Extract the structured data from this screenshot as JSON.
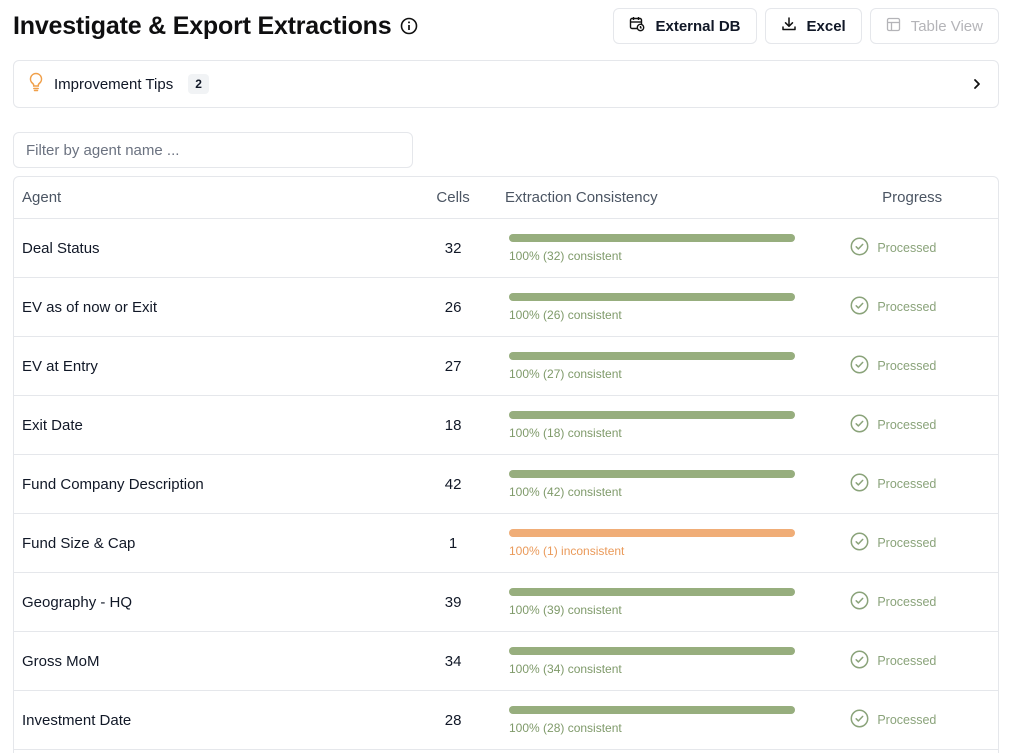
{
  "header": {
    "title": "Investigate & Export Extractions",
    "info_icon": "info-icon",
    "actions": {
      "external_db": "External DB",
      "excel": "Excel",
      "table_view": "Table View"
    }
  },
  "tips": {
    "icon": "lightbulb-icon",
    "label": "Improvement Tips",
    "count": "2"
  },
  "filter": {
    "placeholder": "Filter by agent name ..."
  },
  "table": {
    "headers": {
      "agent": "Agent",
      "cells": "Cells",
      "consistency": "Extraction Consistency",
      "progress": "Progress"
    },
    "rows": [
      {
        "agent": "Deal Status",
        "cells": "32",
        "consistency_text": "100% (32) consistent",
        "fraction": 1.0,
        "status": "ok",
        "progress": "Processed"
      },
      {
        "agent": "EV as of now or Exit",
        "cells": "26",
        "consistency_text": "100% (26) consistent",
        "fraction": 1.0,
        "status": "ok",
        "progress": "Processed"
      },
      {
        "agent": "EV at Entry",
        "cells": "27",
        "consistency_text": "100% (27) consistent",
        "fraction": 1.0,
        "status": "ok",
        "progress": "Processed"
      },
      {
        "agent": "Exit Date",
        "cells": "18",
        "consistency_text": "100% (18) consistent",
        "fraction": 1.0,
        "status": "ok",
        "progress": "Processed"
      },
      {
        "agent": "Fund Company Description",
        "cells": "42",
        "consistency_text": "100% (42) consistent",
        "fraction": 1.0,
        "status": "ok",
        "progress": "Processed"
      },
      {
        "agent": "Fund Size & Cap",
        "cells": "1",
        "consistency_text": "100% (1) inconsistent",
        "fraction": 1.0,
        "status": "warn",
        "progress": "Processed"
      },
      {
        "agent": "Geography - HQ",
        "cells": "39",
        "consistency_text": "100% (39) consistent",
        "fraction": 1.0,
        "status": "ok",
        "progress": "Processed"
      },
      {
        "agent": "Gross MoM",
        "cells": "34",
        "consistency_text": "100% (34) consistent",
        "fraction": 1.0,
        "status": "ok",
        "progress": "Processed"
      },
      {
        "agent": "Investment Date",
        "cells": "28",
        "consistency_text": "100% (28) consistent",
        "fraction": 1.0,
        "status": "ok",
        "progress": "Processed"
      }
    ]
  },
  "colors": {
    "consistent": "#97ae7e",
    "consistent_text": "#7f9a6a",
    "inconsistent": "#f0ad77",
    "inconsistent_text": "#ea9a5a",
    "processed": "#8aa37a",
    "tip_icon": "#f0a04b"
  }
}
